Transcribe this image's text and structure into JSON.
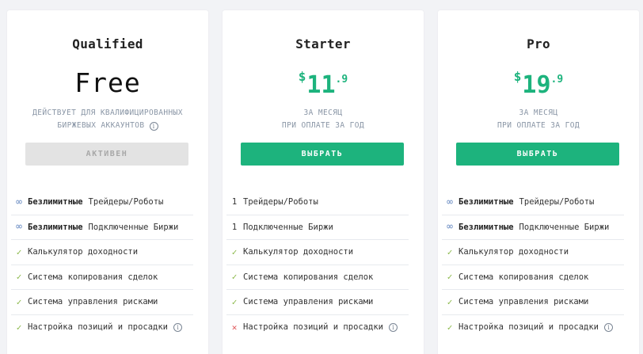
{
  "plans": [
    {
      "name": "Qualified",
      "price": "Free",
      "sub_line1": "ДЕЙСТВУЕТ ДЛЯ КВАЛИФИЦИРОВАННЫХ",
      "sub_line2": "БИРЖЕВЫХ АККАУНТОВ",
      "button": "АКТИВЕН",
      "features": [
        {
          "icon": "infinity-icon",
          "mark": "∞",
          "bold": "Безлимитные",
          "text": "Трейдеры/Роботы"
        },
        {
          "icon": "infinity-icon",
          "mark": "∞",
          "bold": "Безлимитные",
          "text": "Подключенные Биржи"
        },
        {
          "icon": "check-icon",
          "mark": "✓",
          "text": "Калькулятор доходности"
        },
        {
          "icon": "check-icon",
          "mark": "✓",
          "text": "Система копирования сделок"
        },
        {
          "icon": "check-icon",
          "mark": "✓",
          "text": "Система управления рисками"
        },
        {
          "icon": "check-icon",
          "mark": "✓",
          "text": "Настройка позиций и просадки"
        }
      ]
    },
    {
      "name": "Starter",
      "currency": "$",
      "price_int": "11",
      "price_dec": ".9",
      "sub_line1": "ЗА МЕСЯЦ",
      "sub_line2": "ПРИ ОПЛАТЕ ЗА ГОД",
      "button": "ВЫБРАТЬ",
      "features": [
        {
          "icon": "count-label",
          "mark": "1",
          "text": "Трейдеры/Роботы"
        },
        {
          "icon": "count-label",
          "mark": "1",
          "text": "Подключенные Биржи"
        },
        {
          "icon": "check-icon",
          "mark": "✓",
          "text": "Калькулятор доходности"
        },
        {
          "icon": "check-icon",
          "mark": "✓",
          "text": "Система копирования сделок"
        },
        {
          "icon": "check-icon",
          "mark": "✓",
          "text": "Система управления рисками"
        },
        {
          "icon": "cross-icon",
          "mark": "✕",
          "text": "Настройка позиций и просадки"
        }
      ]
    },
    {
      "name": "Pro",
      "currency": "$",
      "price_int": "19",
      "price_dec": ".9",
      "sub_line1": "ЗА МЕСЯЦ",
      "sub_line2": "ПРИ ОПЛАТЕ ЗА ГОД",
      "button": "ВЫБРАТЬ",
      "features": [
        {
          "icon": "infinity-icon",
          "mark": "∞",
          "bold": "Безлимитные",
          "text": "Трейдеры/Роботы"
        },
        {
          "icon": "infinity-icon",
          "mark": "∞",
          "bold": "Безлимитные",
          "text": "Подключенные Биржи"
        },
        {
          "icon": "check-icon",
          "mark": "✓",
          "text": "Калькулятор доходности"
        },
        {
          "icon": "check-icon",
          "mark": "✓",
          "text": "Система копирования сделок"
        },
        {
          "icon": "check-icon",
          "mark": "✓",
          "text": "Система управления рисками"
        },
        {
          "icon": "check-icon",
          "mark": "✓",
          "text": "Настройка позиций и просадки"
        }
      ]
    }
  ],
  "info_glyph": "i",
  "colors": {
    "accent": "#1db37d",
    "check": "#8ab848",
    "cross": "#e0585a",
    "infinity": "#6e8fc4",
    "muted": "#8a96a6"
  }
}
